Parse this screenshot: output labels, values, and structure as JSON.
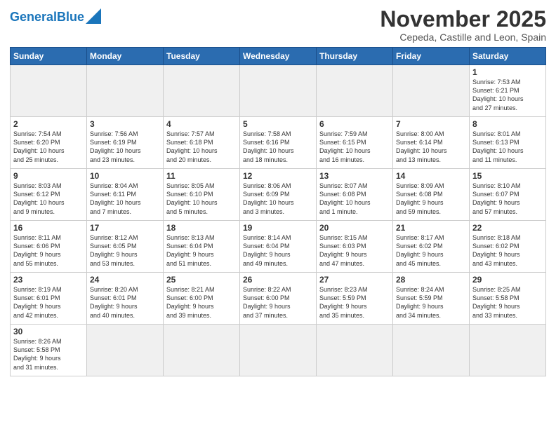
{
  "logo": {
    "part1": "General",
    "part2": "Blue"
  },
  "title": "November 2025",
  "subtitle": "Cepeda, Castille and Leon, Spain",
  "days_of_week": [
    "Sunday",
    "Monday",
    "Tuesday",
    "Wednesday",
    "Thursday",
    "Friday",
    "Saturday"
  ],
  "weeks": [
    [
      {
        "day": "",
        "info": "",
        "empty": true
      },
      {
        "day": "",
        "info": "",
        "empty": true
      },
      {
        "day": "",
        "info": "",
        "empty": true
      },
      {
        "day": "",
        "info": "",
        "empty": true
      },
      {
        "day": "",
        "info": "",
        "empty": true
      },
      {
        "day": "",
        "info": "",
        "empty": true
      },
      {
        "day": "1",
        "info": "Sunrise: 7:53 AM\nSunset: 6:21 PM\nDaylight: 10 hours\nand 27 minutes."
      }
    ],
    [
      {
        "day": "2",
        "info": "Sunrise: 7:54 AM\nSunset: 6:20 PM\nDaylight: 10 hours\nand 25 minutes."
      },
      {
        "day": "3",
        "info": "Sunrise: 7:56 AM\nSunset: 6:19 PM\nDaylight: 10 hours\nand 23 minutes."
      },
      {
        "day": "4",
        "info": "Sunrise: 7:57 AM\nSunset: 6:18 PM\nDaylight: 10 hours\nand 20 minutes."
      },
      {
        "day": "5",
        "info": "Sunrise: 7:58 AM\nSunset: 6:16 PM\nDaylight: 10 hours\nand 18 minutes."
      },
      {
        "day": "6",
        "info": "Sunrise: 7:59 AM\nSunset: 6:15 PM\nDaylight: 10 hours\nand 16 minutes."
      },
      {
        "day": "7",
        "info": "Sunrise: 8:00 AM\nSunset: 6:14 PM\nDaylight: 10 hours\nand 13 minutes."
      },
      {
        "day": "8",
        "info": "Sunrise: 8:01 AM\nSunset: 6:13 PM\nDaylight: 10 hours\nand 11 minutes."
      }
    ],
    [
      {
        "day": "9",
        "info": "Sunrise: 8:03 AM\nSunset: 6:12 PM\nDaylight: 10 hours\nand 9 minutes."
      },
      {
        "day": "10",
        "info": "Sunrise: 8:04 AM\nSunset: 6:11 PM\nDaylight: 10 hours\nand 7 minutes."
      },
      {
        "day": "11",
        "info": "Sunrise: 8:05 AM\nSunset: 6:10 PM\nDaylight: 10 hours\nand 5 minutes."
      },
      {
        "day": "12",
        "info": "Sunrise: 8:06 AM\nSunset: 6:09 PM\nDaylight: 10 hours\nand 3 minutes."
      },
      {
        "day": "13",
        "info": "Sunrise: 8:07 AM\nSunset: 6:08 PM\nDaylight: 10 hours\nand 1 minute."
      },
      {
        "day": "14",
        "info": "Sunrise: 8:09 AM\nSunset: 6:08 PM\nDaylight: 9 hours\nand 59 minutes."
      },
      {
        "day": "15",
        "info": "Sunrise: 8:10 AM\nSunset: 6:07 PM\nDaylight: 9 hours\nand 57 minutes."
      }
    ],
    [
      {
        "day": "16",
        "info": "Sunrise: 8:11 AM\nSunset: 6:06 PM\nDaylight: 9 hours\nand 55 minutes."
      },
      {
        "day": "17",
        "info": "Sunrise: 8:12 AM\nSunset: 6:05 PM\nDaylight: 9 hours\nand 53 minutes."
      },
      {
        "day": "18",
        "info": "Sunrise: 8:13 AM\nSunset: 6:04 PM\nDaylight: 9 hours\nand 51 minutes."
      },
      {
        "day": "19",
        "info": "Sunrise: 8:14 AM\nSunset: 6:04 PM\nDaylight: 9 hours\nand 49 minutes."
      },
      {
        "day": "20",
        "info": "Sunrise: 8:15 AM\nSunset: 6:03 PM\nDaylight: 9 hours\nand 47 minutes."
      },
      {
        "day": "21",
        "info": "Sunrise: 8:17 AM\nSunset: 6:02 PM\nDaylight: 9 hours\nand 45 minutes."
      },
      {
        "day": "22",
        "info": "Sunrise: 8:18 AM\nSunset: 6:02 PM\nDaylight: 9 hours\nand 43 minutes."
      }
    ],
    [
      {
        "day": "23",
        "info": "Sunrise: 8:19 AM\nSunset: 6:01 PM\nDaylight: 9 hours\nand 42 minutes."
      },
      {
        "day": "24",
        "info": "Sunrise: 8:20 AM\nSunset: 6:01 PM\nDaylight: 9 hours\nand 40 minutes."
      },
      {
        "day": "25",
        "info": "Sunrise: 8:21 AM\nSunset: 6:00 PM\nDaylight: 9 hours\nand 39 minutes."
      },
      {
        "day": "26",
        "info": "Sunrise: 8:22 AM\nSunset: 6:00 PM\nDaylight: 9 hours\nand 37 minutes."
      },
      {
        "day": "27",
        "info": "Sunrise: 8:23 AM\nSunset: 5:59 PM\nDaylight: 9 hours\nand 35 minutes."
      },
      {
        "day": "28",
        "info": "Sunrise: 8:24 AM\nSunset: 5:59 PM\nDaylight: 9 hours\nand 34 minutes."
      },
      {
        "day": "29",
        "info": "Sunrise: 8:25 AM\nSunset: 5:58 PM\nDaylight: 9 hours\nand 33 minutes."
      }
    ],
    [
      {
        "day": "30",
        "info": "Sunrise: 8:26 AM\nSunset: 5:58 PM\nDaylight: 9 hours\nand 31 minutes."
      },
      {
        "day": "",
        "info": "",
        "empty": true
      },
      {
        "day": "",
        "info": "",
        "empty": true
      },
      {
        "day": "",
        "info": "",
        "empty": true
      },
      {
        "day": "",
        "info": "",
        "empty": true
      },
      {
        "day": "",
        "info": "",
        "empty": true
      },
      {
        "day": "",
        "info": "",
        "empty": true
      }
    ]
  ]
}
